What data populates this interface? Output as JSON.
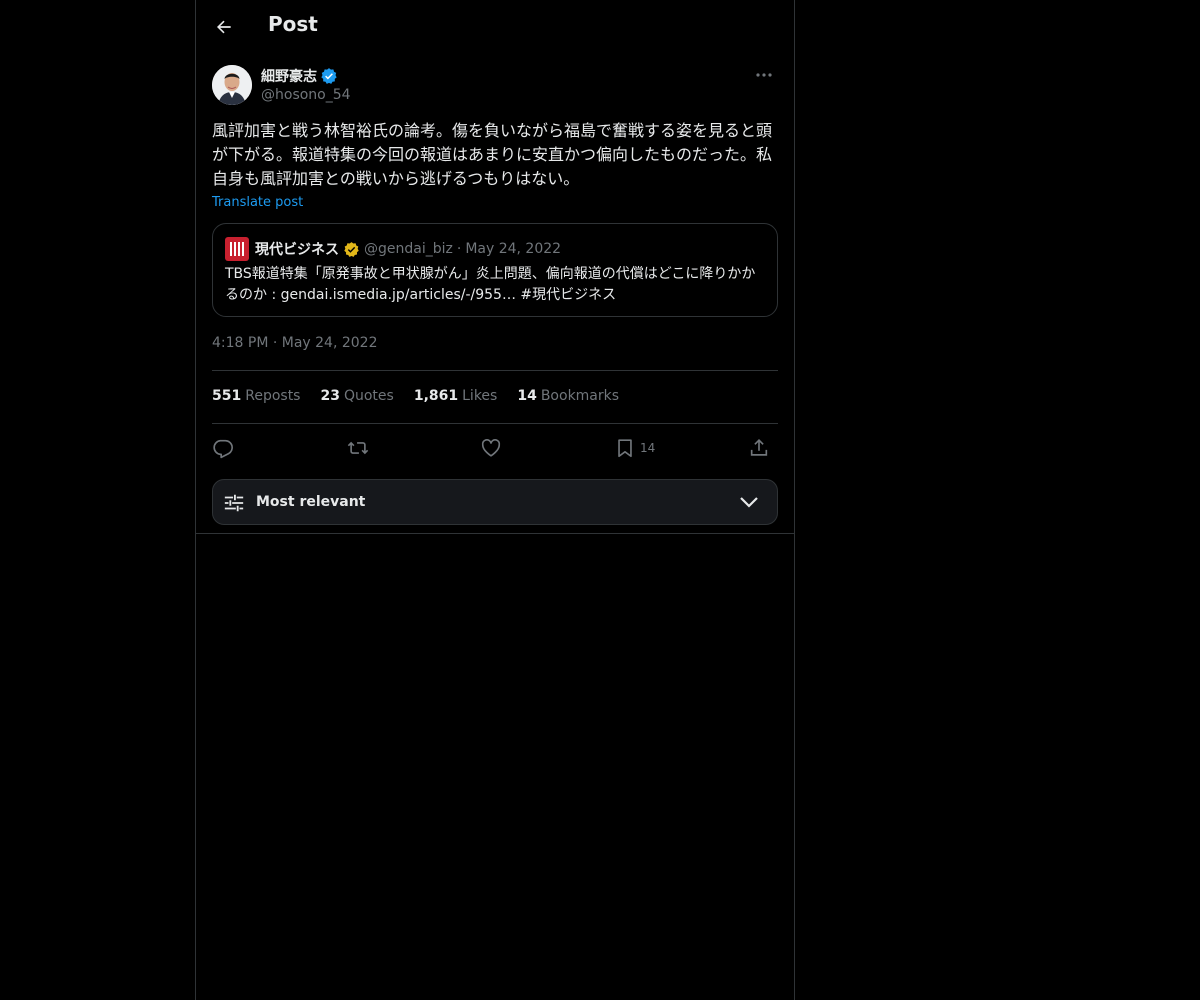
{
  "header": {
    "title": "Post"
  },
  "author": {
    "name": "細野豪志",
    "handle": "@hosono_54",
    "verified_color": "#1d9bf0"
  },
  "post": {
    "text": "風評加害と戦う林智裕氏の論考。傷を負いながら福島で奮戦する姿を見ると頭が下がる。報道特集の今回の報道はあまりに安直かつ偏向したものだった。私自身も風評加害との戦いから逃げるつもりはない。",
    "translate_label": "Translate post",
    "timestamp": "4:18 PM · May 24, 2022"
  },
  "quote": {
    "name": "現代ビジネス",
    "handle": "@gendai_biz",
    "separator": "·",
    "date": "May 24, 2022",
    "text": "TBS報道特集「原発事故と甲状腺がん」炎上問題、偏向報道の代償はどこに降りかかるのか : gendai.ismedia.jp/articles/-/955… #現代ビジネス",
    "badge_color": "#e2b719",
    "logo_color": "#c8202f"
  },
  "stats": [
    {
      "value": "551",
      "label": "Reposts"
    },
    {
      "value": "23",
      "label": "Quotes"
    },
    {
      "value": "1,861",
      "label": "Likes"
    },
    {
      "value": "14",
      "label": "Bookmarks"
    }
  ],
  "actions": {
    "reply_icon": "reply-icon",
    "repost_icon": "repost-icon",
    "like_icon": "heart-icon",
    "bookmark_icon": "bookmark-icon",
    "bookmark_count": "14",
    "share_icon": "share-icon"
  },
  "sort": {
    "label": "Most relevant"
  }
}
